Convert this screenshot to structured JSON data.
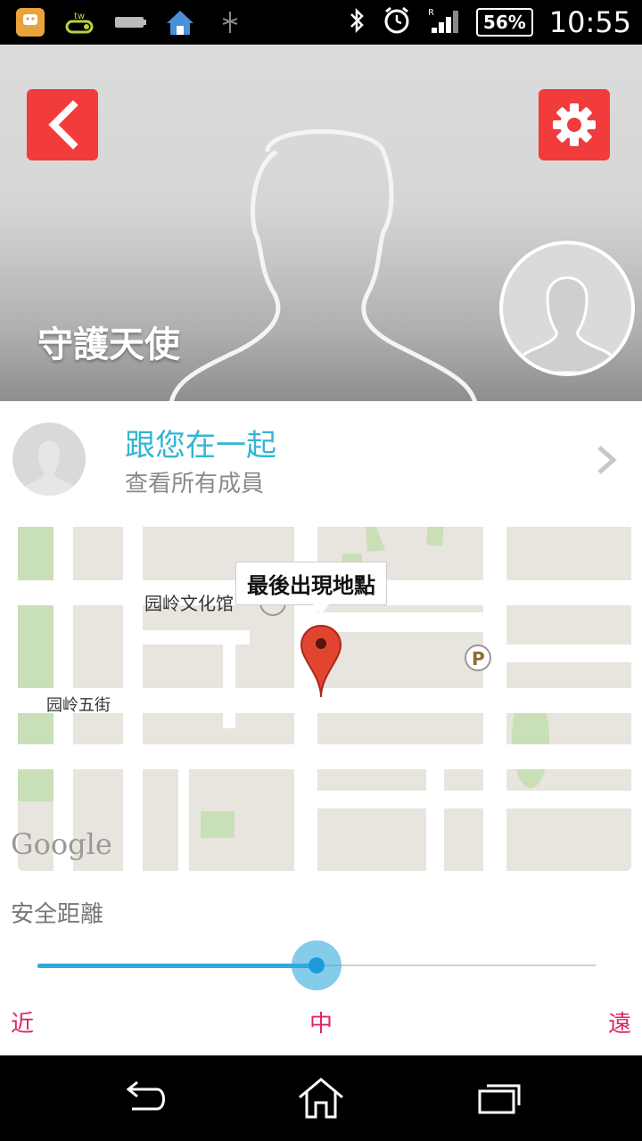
{
  "status_bar": {
    "battery": "56%",
    "time": "10:55",
    "left_icons": [
      "app-notification-icon",
      "tw-app-icon",
      "battery-device-icon",
      "home-app-icon",
      "usb-debug-icon"
    ],
    "right_icons": [
      "bluetooth-icon",
      "alarm-icon",
      "signal-icon"
    ]
  },
  "header": {
    "title": "守護天使",
    "accent_color": "#f23b3b"
  },
  "member": {
    "title": "跟您在一起",
    "subtitle": "查看所有成員"
  },
  "map": {
    "callout": "最後出現地點",
    "place_label_1": "园岭文化馆",
    "place_label_2": "园岭五街",
    "logo": "Google"
  },
  "safety": {
    "label": "安全距離",
    "value_fraction": 0.5,
    "near": "近",
    "mid": "中",
    "far": "遠"
  }
}
